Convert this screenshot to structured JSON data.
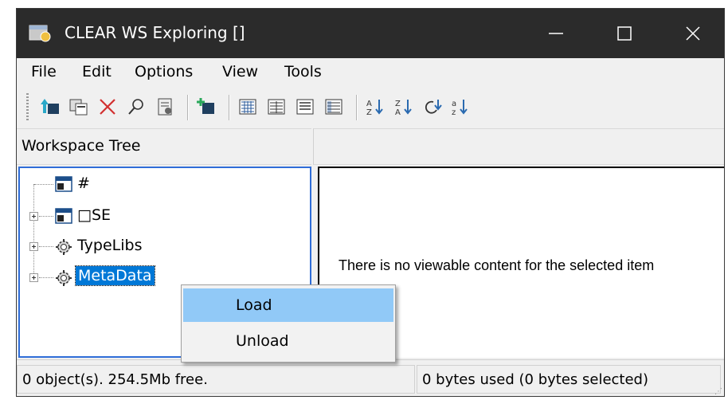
{
  "window": {
    "title": "CLEAR WS Exploring []"
  },
  "menu": {
    "items": [
      "File",
      "Edit",
      "Options",
      "View",
      "Tools"
    ]
  },
  "toolbar": {
    "icons": [
      "up-folder-icon",
      "copy-icon",
      "delete-icon",
      "find-icon",
      "properties-icon",
      "new-item-icon",
      "large-icons-view-icon",
      "small-icons-view-icon",
      "list-view-icon",
      "details-view-icon",
      "sort-ascending-icon",
      "sort-descending-icon",
      "refresh-icon",
      "sort-toggle-icon"
    ]
  },
  "panes": {
    "tree_header": "Workspace Tree",
    "content_header": ""
  },
  "tree": {
    "nodes": [
      {
        "label": "#",
        "icon": "workspace-icon",
        "expandable": false
      },
      {
        "label": "□SE",
        "icon": "workspace-icon",
        "expandable": true
      },
      {
        "label": "TypeLibs",
        "icon": "gear-icon",
        "expandable": true
      },
      {
        "label": "MetaData",
        "icon": "gear-icon",
        "expandable": true,
        "selected": true
      }
    ]
  },
  "content": {
    "message": "There is no viewable content for the selected item"
  },
  "context_menu": {
    "items": [
      {
        "label": "Load",
        "highlighted": true
      },
      {
        "label": "Unload",
        "highlighted": false
      }
    ]
  },
  "status": {
    "left": "0 object(s). 254.5Mb free.",
    "right": "0 bytes used (0 bytes selected)"
  },
  "colors": {
    "titlebar": "#2b2b2b",
    "tree_border": "#2f6dd8",
    "selection": "#0078d7",
    "menu_highlight": "#91c9f7"
  }
}
